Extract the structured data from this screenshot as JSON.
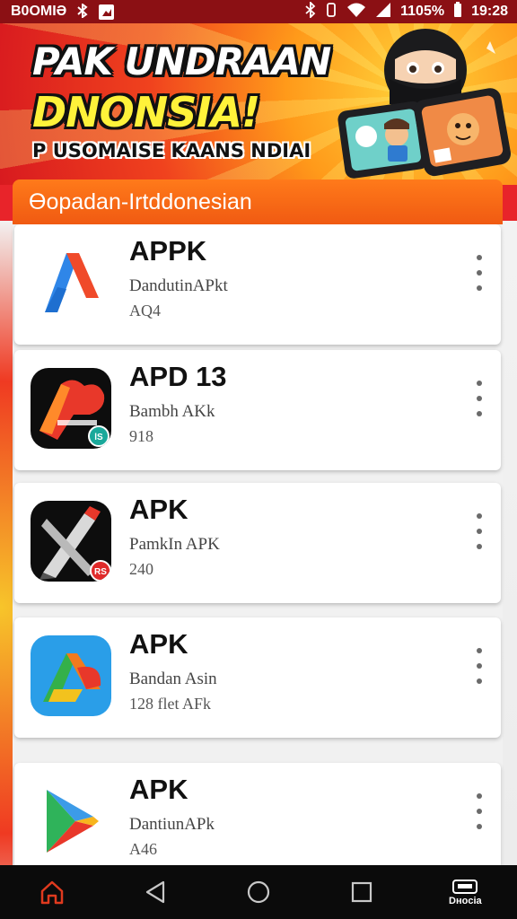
{
  "status_bar": {
    "carrier": "B0OMIƏ",
    "battery": "1105%",
    "time": "19:28"
  },
  "banner": {
    "title_line1": "PAK UNDRAAN",
    "title_line2": "DNONSIA!",
    "subtitle": "P USOMAISE KAANS NDIAI"
  },
  "section": {
    "title": "Ɵopadan-Irtddonesian"
  },
  "apps": [
    {
      "title": "APPK",
      "subtitle": "DandutinAPkt",
      "size": "AQ4",
      "icon": "red-blue-a-icon"
    },
    {
      "title": "APD 13",
      "subtitle": "Bambh AKk",
      "size": "918",
      "icon": "red-orange-cloud-icon"
    },
    {
      "title": "APK",
      "subtitle": "PamkIn APK",
      "size": "240",
      "icon": "pen-tools-icon"
    },
    {
      "title": "APK",
      "subtitle": "Bandan Asin",
      "size": "128 flet AFk",
      "icon": "colorful-a-icon"
    },
    {
      "title": "APK",
      "subtitle": "DantiunAPk",
      "size": "A46",
      "icon": "play-store-icon"
    }
  ],
  "nav": {
    "last_label": "Dʜocia"
  },
  "colors": {
    "header_orange": "#f26418",
    "banner_red": "#e8242a",
    "status_bar": "#8b1014",
    "nav_bg": "#0b0b0b",
    "home_active": "#e03a1e"
  }
}
